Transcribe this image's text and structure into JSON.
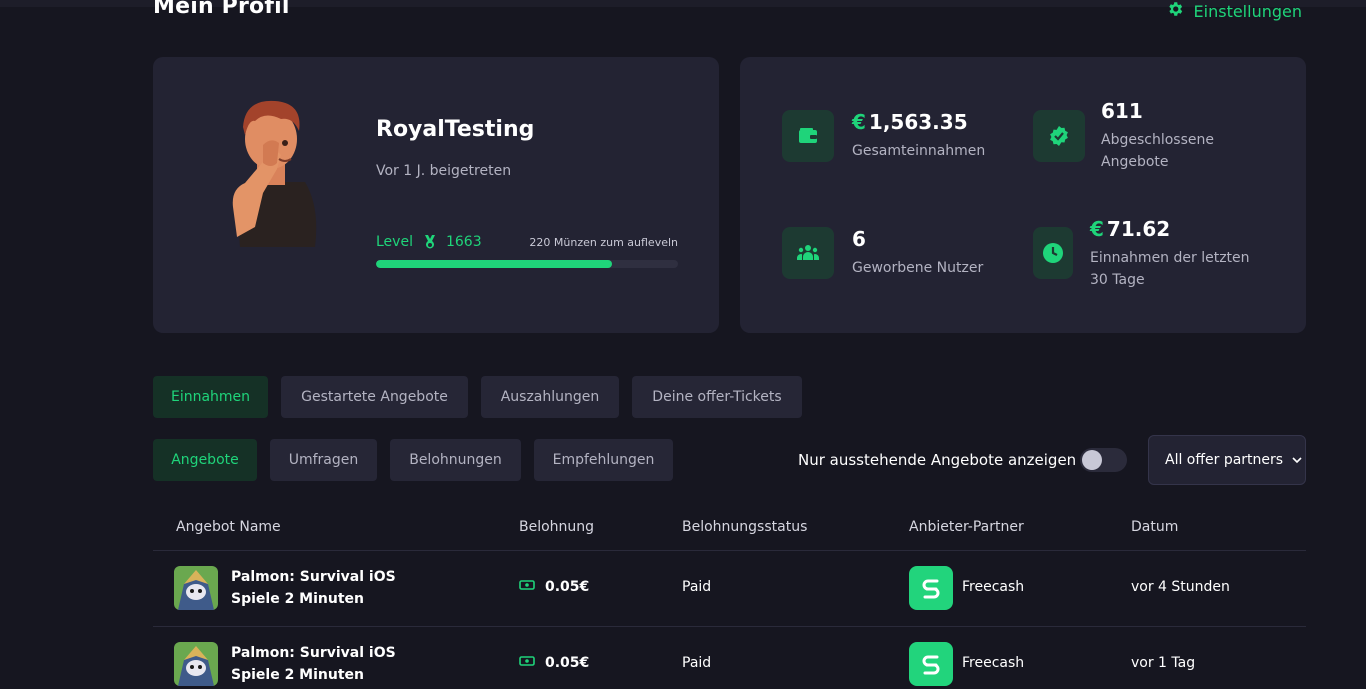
{
  "header": {
    "title": "Mein Profil",
    "settings_label": "Einstellungen",
    "settings_icon": "gear-icon"
  },
  "profile": {
    "username": "RoyalTesting",
    "joined": "Vor 1 J. beigetreten",
    "level_label": "Level",
    "level_value": "1663",
    "level_hint": "220 Münzen zum auflevel­n",
    "progress_fraction": 0.78
  },
  "stats": [
    {
      "currency": "€",
      "value": "1,563.35",
      "label": "Gesamteinnahmen",
      "icon": "wallet-icon"
    },
    {
      "currency": "",
      "value": "611",
      "label": "Abgeschlossene Angebote",
      "icon": "check-badge-icon"
    },
    {
      "currency": "",
      "value": "6",
      "label": "Geworbene Nutzer",
      "icon": "users-icon"
    },
    {
      "currency": "€",
      "value": "71.62",
      "label": "Einnahmen der letzten 30 Tage",
      "icon": "clock-icon"
    }
  ],
  "main_tabs": [
    "Einnahmen",
    "Gestartete Angebote",
    "Auszahlungen",
    "Deine offer-Tickets"
  ],
  "sub_tabs": [
    "Angebote",
    "Umfragen",
    "Belohnungen",
    "Empfehlungen"
  ],
  "filter": {
    "toggle_label": "Nur ausstehende Angebote anzeigen",
    "toggle_on": false,
    "partner_select": "All offer partners"
  },
  "table": {
    "columns": [
      "Angebot Name",
      "Belohnung",
      "Belohnungsstatus",
      "Anbieter-Partner",
      "Datum"
    ],
    "rows": [
      {
        "name": "Palmon: Survival iOS Spiele 2 Minuten",
        "reward": "0.05€",
        "status": "Paid",
        "partner": "Freecash",
        "date": "vor 4 Stunden"
      },
      {
        "name": "Palmon: Survival iOS Spiele 2 Minuten",
        "reward": "0.05€",
        "status": "Paid",
        "partner": "Freecash",
        "date": "vor 1 Tag"
      }
    ]
  },
  "colors": {
    "accent": "#1fd47a",
    "background": "#161620",
    "card": "#232333"
  }
}
